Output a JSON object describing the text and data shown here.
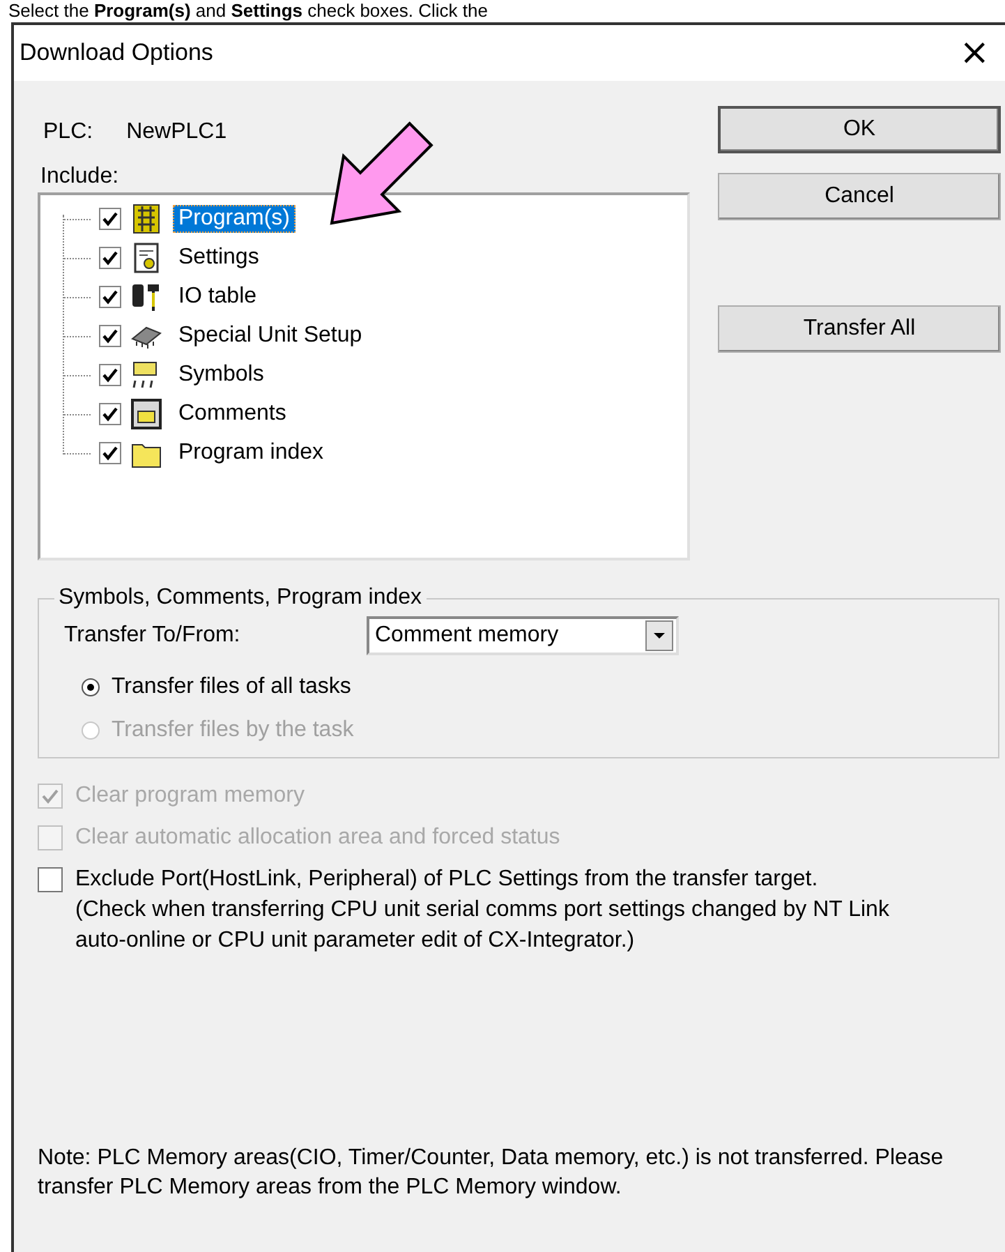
{
  "instruction": "Select the **Program(s)** and **Settings** check boxes. Click the",
  "window": {
    "title": "Download Options",
    "close": "×"
  },
  "plc": {
    "label": "PLC:",
    "value": "NewPLC1"
  },
  "include": {
    "label": "Include:",
    "items": [
      {
        "label": "Program(s)",
        "checked": true,
        "selected": true,
        "kind": "program"
      },
      {
        "label": "Settings",
        "checked": true,
        "selected": false,
        "kind": "settings"
      },
      {
        "label": "IO table",
        "checked": true,
        "selected": false,
        "kind": "io"
      },
      {
        "label": "Special Unit Setup",
        "checked": true,
        "selected": false,
        "kind": "chip"
      },
      {
        "label": "Symbols",
        "checked": true,
        "selected": false,
        "kind": "symbols"
      },
      {
        "label": "Comments",
        "checked": true,
        "selected": false,
        "kind": "comments"
      },
      {
        "label": "Program index",
        "checked": true,
        "selected": false,
        "kind": "folder"
      }
    ]
  },
  "buttons": [
    {
      "label": "OK",
      "default": true
    },
    {
      "label": "Cancel",
      "default": false
    },
    {
      "label": "Transfer All",
      "default": false
    }
  ],
  "group": {
    "title": "Symbols, Comments, Program index",
    "transfer_label": "Transfer To/From:",
    "transfer_value": "Comment memory",
    "radios": [
      {
        "label": "Transfer files of all tasks",
        "selected": true,
        "disabled": false
      },
      {
        "label": "Transfer files by the task",
        "selected": false,
        "disabled": true
      }
    ]
  },
  "options": [
    {
      "label": "Clear program memory",
      "checked": true,
      "disabled": true
    },
    {
      "label": "Clear automatic allocation area and forced status",
      "checked": false,
      "disabled": true
    },
    {
      "label": "Exclude Port(HostLink, Peripheral) of PLC Settings from the transfer target.",
      "detail": "(Check when transferring CPU unit serial comms port settings changed by NT Link auto-online or CPU unit parameter edit of CX-Integrator.)",
      "checked": false,
      "disabled": false
    }
  ],
  "note": "Note: PLC Memory areas(CIO, Timer/Counter, Data memory, etc.) is not transferred. Please transfer PLC Memory areas from the PLC Memory window."
}
